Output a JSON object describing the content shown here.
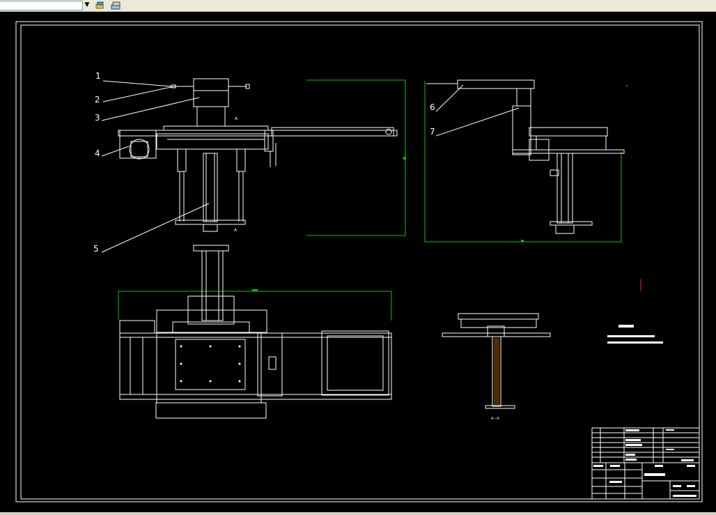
{
  "app": {
    "toolbar": {
      "layer_combo_value": "",
      "icons": [
        "layer-state-icon",
        "layer-properties-icon"
      ]
    }
  },
  "drawing": {
    "balloons": [
      "1",
      "2",
      "3",
      "4",
      "5",
      "6",
      "7"
    ],
    "section_label": "A—A",
    "section_marks": [
      "A",
      "A"
    ],
    "colors": {
      "linework": "#ffffff",
      "dimension": "#00c800",
      "red_mark": "#ff2020",
      "background": "#000000"
    }
  }
}
